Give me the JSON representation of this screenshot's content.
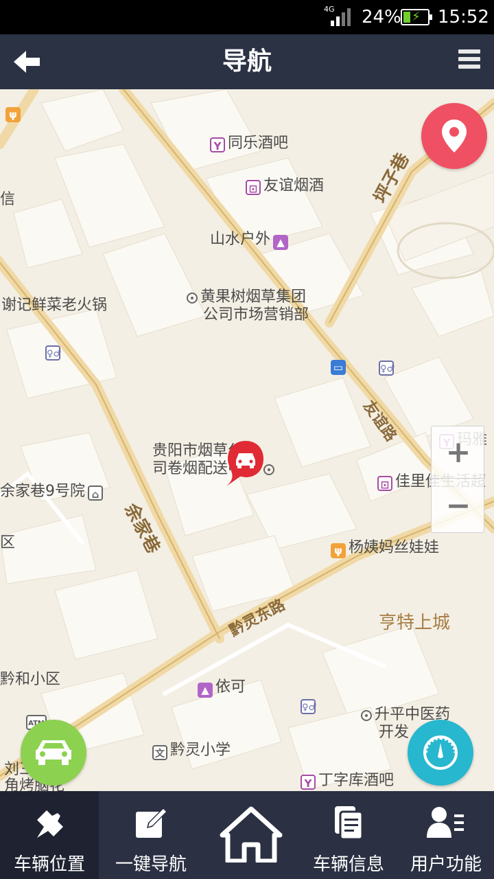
{
  "status_bar": {
    "network": "4G",
    "battery_percent": "24%",
    "time": "15:52",
    "battery_color": "#6fcf30"
  },
  "header": {
    "title": "导航",
    "back_icon": "arrow-left-icon",
    "menu_icon": "menu-icon",
    "background": "#2a3244"
  },
  "map": {
    "pois": [
      {
        "name": "同乐酒吧",
        "icon": "bar-icon"
      },
      {
        "name": "友谊烟酒",
        "icon": "shop-icon"
      },
      {
        "name": "山水户外",
        "icon": "bag-icon"
      },
      {
        "name": "黄果树烟草集团",
        "icon": "place-icon"
      },
      {
        "name": "公司市场营销部",
        "icon": ""
      },
      {
        "name": "谢记鲜菜老火锅",
        "icon": ""
      },
      {
        "name": "信",
        "icon": ""
      },
      {
        "name": "贵阳市烟草公",
        "icon": ""
      },
      {
        "name": "司卷烟配送中心",
        "icon": ""
      },
      {
        "name": "余家巷9号院",
        "icon": "home-icon"
      },
      {
        "name": "区",
        "icon": ""
      },
      {
        "name": "佳里佳生活超",
        "icon": "shop-icon"
      },
      {
        "name": "玛雅",
        "icon": "bar-icon"
      },
      {
        "name": "杨姨妈丝娃娃",
        "icon": "food-icon"
      },
      {
        "name": "黔和小区",
        "icon": "place-icon"
      },
      {
        "name": "依可",
        "icon": "bag-icon"
      },
      {
        "name": "升平中医药",
        "icon": "place-icon"
      },
      {
        "name": "开发",
        "icon": ""
      },
      {
        "name": "黔灵小学",
        "icon": "school-icon"
      },
      {
        "name": "刘三",
        "icon": ""
      },
      {
        "name": "角烤脑花",
        "icon": ""
      },
      {
        "name": "丁字库酒吧",
        "icon": "bar-icon"
      },
      {
        "name": "ATM",
        "icon": "atm-icon"
      }
    ],
    "roads": {
      "pingzi": "坪子巷",
      "youyi": "友谊路",
      "yujia": "余家巷",
      "qianling": "黔灵东路"
    },
    "area": "亨特上城",
    "zoom_in": "+",
    "zoom_out": "−"
  },
  "buttons": {
    "locate_icon": "location-pin-icon",
    "car_fab_icon": "car-icon",
    "gauge_fab_icon": "speedometer-icon"
  },
  "tabs": [
    {
      "label": "车辆位置",
      "icon": "pin-icon",
      "active": true
    },
    {
      "label": "一键导航",
      "icon": "edit-icon",
      "active": false
    },
    {
      "label": "",
      "icon": "home-icon",
      "active": false
    },
    {
      "label": "车辆信息",
      "icon": "document-icon",
      "active": false
    },
    {
      "label": "用户功能",
      "icon": "user-list-icon",
      "active": false
    }
  ]
}
